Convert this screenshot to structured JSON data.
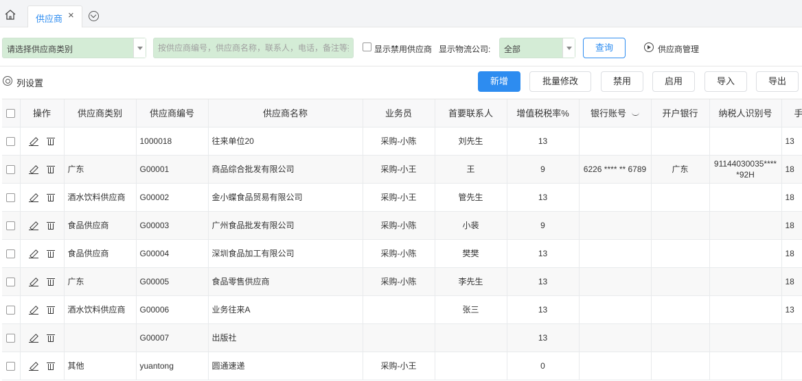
{
  "tabs": {
    "active_label": "供应商",
    "close_glyph": "×"
  },
  "filters": {
    "category_select_value": "请选择供应商类别",
    "search_placeholder": "按供应商编号，供应商名称，联系人，电话，备注等搜索",
    "show_disabled_label": "显示禁用供应商",
    "logistics_label": "显示物流公司:",
    "logistics_value": "全部",
    "query_label": "查询",
    "manage_label": "供应商管理"
  },
  "toolbar": {
    "column_settings": "列设置",
    "add": "新增",
    "batch_edit": "批量修改",
    "disable": "禁用",
    "enable": "启用",
    "import": "导入",
    "export": "导出"
  },
  "table": {
    "headers": [
      "操作",
      "供应商类别",
      "供应商编号",
      "供应商名称",
      "业务员",
      "首要联系人",
      "增值税税率%",
      "银行账号",
      "开户银行",
      "纳税人识别号",
      "手"
    ],
    "rows": [
      {
        "category": "",
        "code": "1000018",
        "name": "往来单位20",
        "salesman": "采购-小陈",
        "contact": "刘先生",
        "tax": "13",
        "bank_account": "",
        "bank": "",
        "tax_id": "",
        "extra": "13"
      },
      {
        "category": "广东",
        "code": "G00001",
        "name": "商品综合批发有限公司",
        "salesman": "采购-小王",
        "contact": "王",
        "tax": "9",
        "bank_account": "6226 **** ** 6789",
        "bank": "广东",
        "tax_id": "91144030035*****92H",
        "extra": "18"
      },
      {
        "category": "酒水饮料供应商",
        "code": "G00002",
        "name": "金小蝶食品贸易有限公司",
        "salesman": "采购-小王",
        "contact": "管先生",
        "tax": "13",
        "bank_account": "",
        "bank": "",
        "tax_id": "",
        "extra": "18"
      },
      {
        "category": "食品供应商",
        "code": "G00003",
        "name": "广州食品批发有限公司",
        "salesman": "采购-小陈",
        "contact": "小裴",
        "tax": "9",
        "bank_account": "",
        "bank": "",
        "tax_id": "",
        "extra": "18"
      },
      {
        "category": "食品供应商",
        "code": "G00004",
        "name": "深圳食品加工有限公司",
        "salesman": "采购-小陈",
        "contact": "樊樊",
        "tax": "13",
        "bank_account": "",
        "bank": "",
        "tax_id": "",
        "extra": "18"
      },
      {
        "category": "广东",
        "code": "G00005",
        "name": "食品零售供应商",
        "salesman": "采购-小陈",
        "contact": "李先生",
        "tax": "13",
        "bank_account": "",
        "bank": "",
        "tax_id": "",
        "extra": "18"
      },
      {
        "category": "酒水饮料供应商",
        "code": "G00006",
        "name": "业务往来A",
        "salesman": "",
        "contact": "张三",
        "tax": "13",
        "bank_account": "",
        "bank": "",
        "tax_id": "",
        "extra": "13"
      },
      {
        "category": "",
        "code": "G00007",
        "name": "出版社",
        "salesman": "",
        "contact": "",
        "tax": "13",
        "bank_account": "",
        "bank": "",
        "tax_id": "",
        "extra": ""
      },
      {
        "category": "其他",
        "code": "yuantong",
        "name": "圆通速递",
        "salesman": "采购-小王",
        "contact": "",
        "tax": "0",
        "bank_account": "",
        "bank": "",
        "tax_id": "",
        "extra": ""
      }
    ]
  }
}
